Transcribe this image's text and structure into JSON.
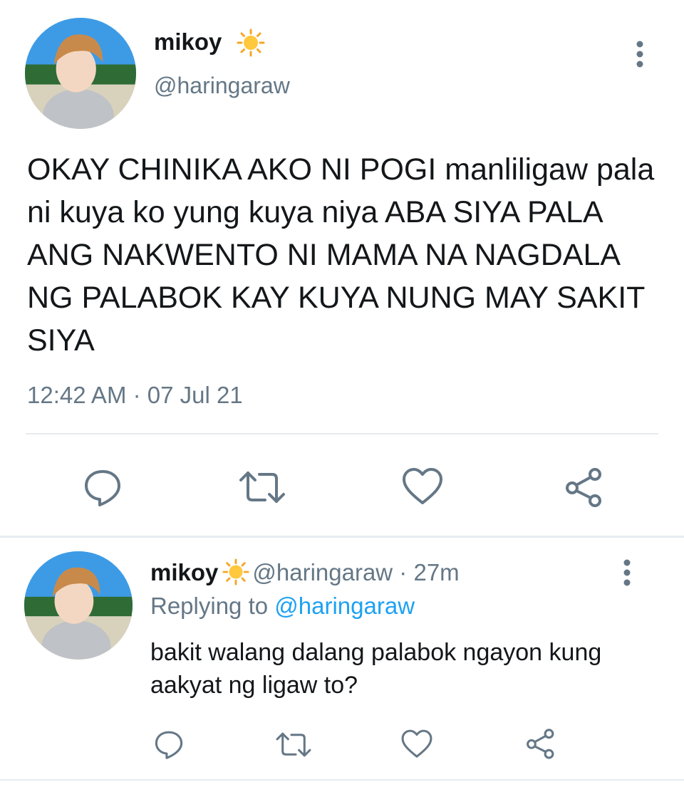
{
  "main_tweet": {
    "display_name": "mikoy",
    "name_emoji": "sun-emoji",
    "handle": "@haringaraw",
    "text": "OKAY CHINIKA AKO NI POGI manliligaw pala ni kuya ko yung kuya niya ABA SIYA PALA ANG NAKWENTO NI MAMA NA NAGDALA NG PALABOK KAY KUYA NUNG MAY SAKIT SIYA",
    "timestamp": "12:42 AM · 07 Jul 21",
    "actions": [
      "reply-icon",
      "retweet-icon",
      "like-icon",
      "share-icon"
    ]
  },
  "reply": {
    "display_name": "mikoy",
    "name_emoji": "sun-emoji",
    "meta": "@haringaraw · 27m",
    "replying_prefix": "Replying to ",
    "replying_to": "@haringaraw",
    "text": "bakit walang dalang palabok ngayon kung aakyat ng ligaw to?",
    "actions": [
      "reply-icon",
      "retweet-icon",
      "like-icon",
      "share-icon"
    ]
  },
  "colors": {
    "text": "#14171a",
    "secondary": "#657786",
    "accent": "#1da1f2",
    "divider": "#e6ecf0"
  }
}
